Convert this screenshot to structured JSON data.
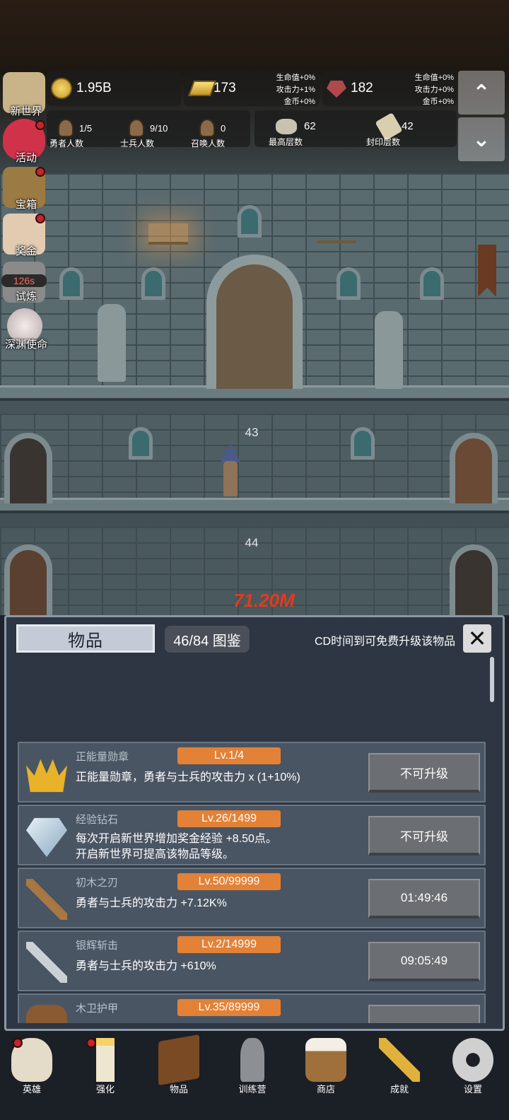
{
  "resources": {
    "gold": "1.95B",
    "goldbar": "173",
    "goldbar_bonus": [
      "生命值+0%",
      "攻击力+1%",
      "金币+0%"
    ],
    "ruby": "182",
    "ruby_bonus": [
      "生命值+0%",
      "攻击力+0%",
      "金币+0%"
    ]
  },
  "counts": [
    {
      "value": "1/5",
      "label": "勇者人数"
    },
    {
      "value": "9/10",
      "label": "士兵人数"
    },
    {
      "value": "0",
      "label": "召唤人数"
    }
  ],
  "floors": [
    {
      "value": "62",
      "label": "最高层数"
    },
    {
      "value": "42",
      "label": "封印层数"
    }
  ],
  "nav_arrows": {
    "up": "⌃",
    "down": "⌄"
  },
  "side_menu": [
    {
      "label": "新世界",
      "dot": false
    },
    {
      "label": "活动",
      "dot": true
    },
    {
      "label": "宝箱",
      "dot": true
    },
    {
      "label": "奖金",
      "dot": true
    },
    {
      "label": "试炼",
      "dot": false,
      "timer": "126s"
    },
    {
      "label": "深渊使命",
      "dot": false
    }
  ],
  "scene": {
    "floor_numbers": [
      "43",
      "44"
    ],
    "damage": "71.20M"
  },
  "items_panel": {
    "title": "物品",
    "catalog": "46/84 图鉴",
    "cd_hint": "CD时间到可免费升级该物品",
    "close": "✕",
    "items": [
      {
        "name": "正能量勋章",
        "level": "Lv.1/4",
        "desc": [
          "正能量勋章，勇者与士兵的攻击力 x (1+10%)"
        ],
        "button": "不可升级",
        "icon": "medal-icon"
      },
      {
        "name": "经验钻石",
        "level": "Lv.26/1499",
        "desc": [
          "每次开启新世界增加奖金经验 +8.50点。",
          "开启新世界可提高该物品等级。"
        ],
        "button": "不可升级",
        "icon": "diamond-icon"
      },
      {
        "name": "初木之刃",
        "level": "Lv.50/99999",
        "desc": [
          "勇者与士兵的攻击力 +7.12K%"
        ],
        "button": "01:49:46",
        "icon": "wooden-sword-icon"
      },
      {
        "name": "银辉斩击",
        "level": "Lv.2/14999",
        "desc": [
          "勇者与士兵的攻击力 +610%"
        ],
        "button": "09:05:49",
        "icon": "silver-sword-icon"
      },
      {
        "name": "木卫护甲",
        "level": "Lv.35/89999",
        "desc": [
          ""
        ],
        "button": "",
        "icon": "armor-icon"
      }
    ]
  },
  "bottom_nav": [
    {
      "label": "英雄",
      "dot": true,
      "icon": "skull-icon"
    },
    {
      "label": "强化",
      "dot": true,
      "icon": "candle-icon"
    },
    {
      "label": "物品",
      "dot": false,
      "icon": "book-icon"
    },
    {
      "label": "训练营",
      "dot": false,
      "icon": "lantern-icon"
    },
    {
      "label": "商店",
      "dot": false,
      "icon": "mug-icon"
    },
    {
      "label": "成就",
      "dot": false,
      "icon": "key-icon"
    },
    {
      "label": "设置",
      "dot": false,
      "icon": "gear-icon"
    }
  ]
}
